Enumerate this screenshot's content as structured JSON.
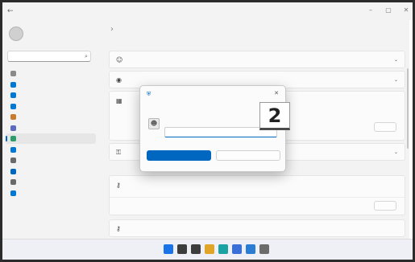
{
  "window": {
    "back_glyph": "←",
    "title": "",
    "controls": [
      "–",
      "▢",
      "✕"
    ]
  },
  "sidebar": {
    "profile_name": "",
    "profile_sub": "",
    "search_placeholder": "",
    "items": [
      {
        "label": "",
        "icon": "home-icon",
        "color": "#8a8a8a"
      },
      {
        "label": "",
        "icon": "system-icon",
        "color": "#0078d4"
      },
      {
        "label": "",
        "icon": "bluetooth-icon",
        "color": "#0078d4"
      },
      {
        "label": "",
        "icon": "network-icon",
        "color": "#0078d4"
      },
      {
        "label": "",
        "icon": "personalization-icon",
        "color": "#c87b2d"
      },
      {
        "label": "",
        "icon": "apps-icon",
        "color": "#5c6bc0"
      },
      {
        "label": "",
        "icon": "accounts-icon",
        "color": "#2e9d6a",
        "active": true
      },
      {
        "label": "",
        "icon": "time-language-icon",
        "color": "#0078d4"
      },
      {
        "label": "",
        "icon": "gaming-icon",
        "color": "#6a6a6a"
      },
      {
        "label": "",
        "icon": "accessibility-icon",
        "color": "#0067c0"
      },
      {
        "label": "",
        "icon": "privacy-security-icon",
        "color": "#6a6a6a"
      },
      {
        "label": "",
        "icon": "windows-update-icon",
        "color": "#0078d4"
      }
    ]
  },
  "main": {
    "breadcrumb_parent": "",
    "breadcrumb_sep": "›",
    "breadcrumb_current": "",
    "section_label": "",
    "cards": {
      "c1": {
        "title": "",
        "desc": "",
        "chev": "⌄"
      },
      "c2": {
        "title": "",
        "desc": "",
        "chev": "⌄"
      },
      "c3": {
        "title": "",
        "desc": "",
        "button": ""
      },
      "c4": {
        "title": "",
        "desc": "",
        "chev": "⌄"
      },
      "c5": {
        "title": "",
        "desc": "",
        "sub": "",
        "button": ""
      },
      "c6": {
        "title": "",
        "desc": ""
      }
    }
  },
  "dialog": {
    "app_name": "",
    "close_glyph": "✕",
    "heading": "",
    "credential_label": "",
    "input_value": "",
    "primary_button": "",
    "secondary_button": ""
  },
  "step_badge": "2",
  "taskbar": {
    "icons": [
      {
        "name": "start-icon",
        "color": "#1a73e8"
      },
      {
        "name": "search-icon",
        "color": "#3d3d3d"
      },
      {
        "name": "task-view-icon",
        "color": "#3d3d3d"
      },
      {
        "name": "file-explorer-icon",
        "color": "#e0a526"
      },
      {
        "name": "edge-icon",
        "color": "#1aa3a3"
      },
      {
        "name": "store-icon",
        "color": "#3a6fd8"
      },
      {
        "name": "mail-icon",
        "color": "#2b7cd3"
      },
      {
        "name": "settings-icon",
        "color": "#6b6b6b"
      }
    ],
    "tray_text": ""
  },
  "colors": {
    "accent": "#0067c0",
    "window_bg": "#f3f3f3",
    "card_bg": "#fbfbfb"
  }
}
